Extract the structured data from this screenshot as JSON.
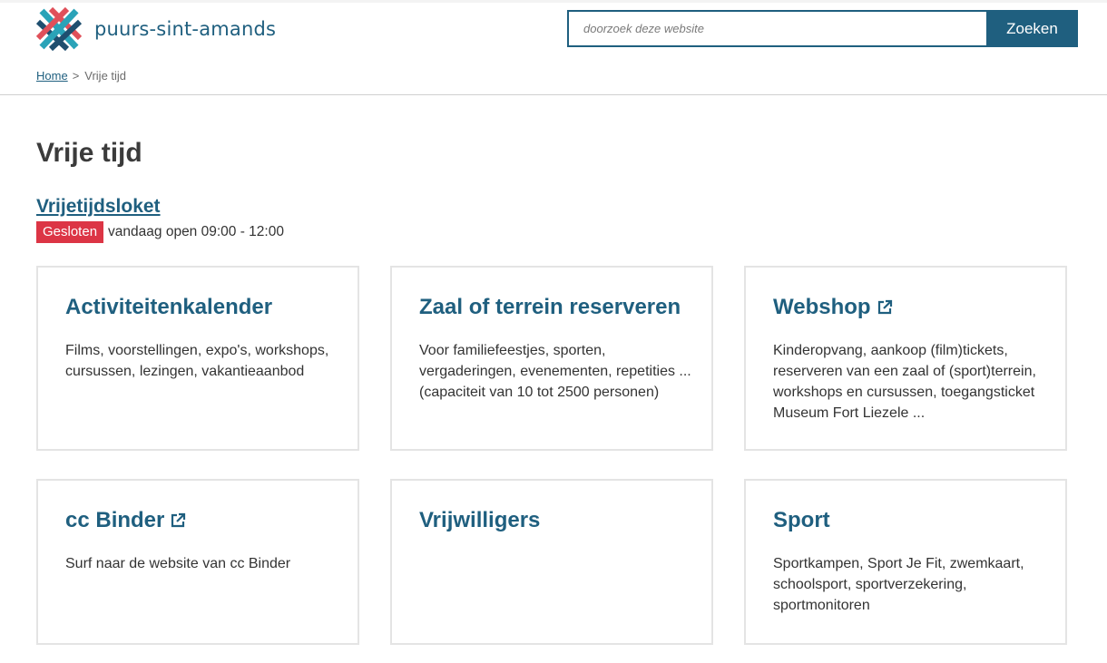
{
  "header": {
    "logo_text": "puurs-sint-amands",
    "search": {
      "placeholder": "doorzoek deze website",
      "button_label": "Zoeken"
    }
  },
  "breadcrumb": {
    "home": "Home",
    "separator": ">",
    "current": "Vrije tijd"
  },
  "page": {
    "title": "Vrije tijd",
    "loket": {
      "title": "Vrijetijdsloket",
      "status": "Gesloten",
      "hours": "vandaag open 09:00 - 12:00"
    }
  },
  "colors": {
    "brand": "#1f5f7f",
    "closed": "#dc3545",
    "logo_red": "#e0505a",
    "logo_teal": "#2aa3b8",
    "logo_navy": "#1f4f6f"
  },
  "cards": [
    {
      "title": "Activiteitenkalender",
      "description": "Films, voorstellingen, expo's, workshops, cursussen, lezingen, vakantieaanbod",
      "external": false
    },
    {
      "title": "Zaal of terrein reserveren",
      "description": "Voor familiefeestjes, sporten, vergaderingen, evenementen, repetities ... (capaciteit van 10 tot 2500 personen)",
      "external": false
    },
    {
      "title": "Webshop",
      "description": "Kinderopvang, aankoop (film)tickets, reserveren van een zaal of (sport)terrein, workshops en cursussen, toegangsticket Museum Fort Liezele ...",
      "external": true
    },
    {
      "title": "cc Binder",
      "description": "Surf naar de website van cc Binder",
      "external": true
    },
    {
      "title": "Vrijwilligers",
      "description": "",
      "external": false
    },
    {
      "title": "Sport",
      "description": "Sportkampen, Sport Je Fit, zwemkaart, schoolsport, sportverzekering, sportmonitoren",
      "external": false
    }
  ]
}
